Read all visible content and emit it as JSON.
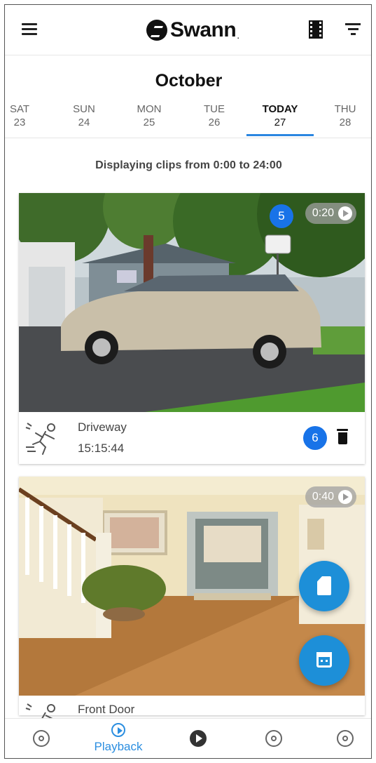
{
  "header": {
    "logo_text": "Swann",
    "logo_suffix": "."
  },
  "month": "October",
  "days": [
    {
      "name": "SAT",
      "date": "23"
    },
    {
      "name": "SUN",
      "date": "24"
    },
    {
      "name": "MON",
      "date": "25"
    },
    {
      "name": "TUE",
      "date": "26"
    },
    {
      "name": "TODAY",
      "date": "27",
      "active": true
    },
    {
      "name": "THU",
      "date": "28"
    }
  ],
  "displaying_text": "Displaying clips from 0:00 to 24:00",
  "clips": [
    {
      "camera": "Driveway",
      "time": "15:15:44",
      "duration": "0:20",
      "badge_duration": "5",
      "badge_delete": "6"
    },
    {
      "camera": "Front Door",
      "duration": "0:40"
    }
  ],
  "bottom_nav": [
    {
      "icon": "bell-icon"
    },
    {
      "icon": "playback-icon",
      "label": "Playback",
      "active": true
    },
    {
      "icon": "play-icon"
    },
    {
      "icon": "globe-icon"
    },
    {
      "icon": "settings-icon"
    }
  ],
  "colors": {
    "accent": "#2b8ee0",
    "badge": "#1873e8",
    "fab": "#1d8fd8"
  }
}
